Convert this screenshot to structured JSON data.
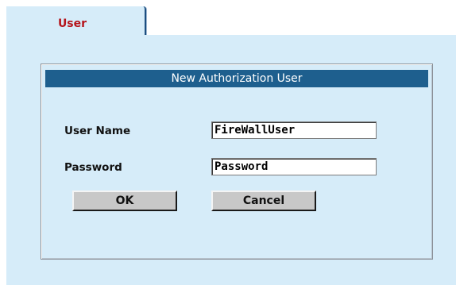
{
  "tabs": [
    {
      "label": "User",
      "selected": true
    }
  ],
  "dialog": {
    "title": "New Authorization User",
    "fields": {
      "user_name": {
        "label": "User Name",
        "value": "FireWallUser"
      },
      "password": {
        "label": "Password",
        "value": "Password"
      }
    },
    "buttons": {
      "ok_label": "OK",
      "cancel_label": "Cancel"
    }
  },
  "colors": {
    "panel_bg": "#d6ecf9",
    "titlebar_bg": "#1e5f8e",
    "tab_label": "#b5141b",
    "button_bg": "#c8c8c8"
  }
}
